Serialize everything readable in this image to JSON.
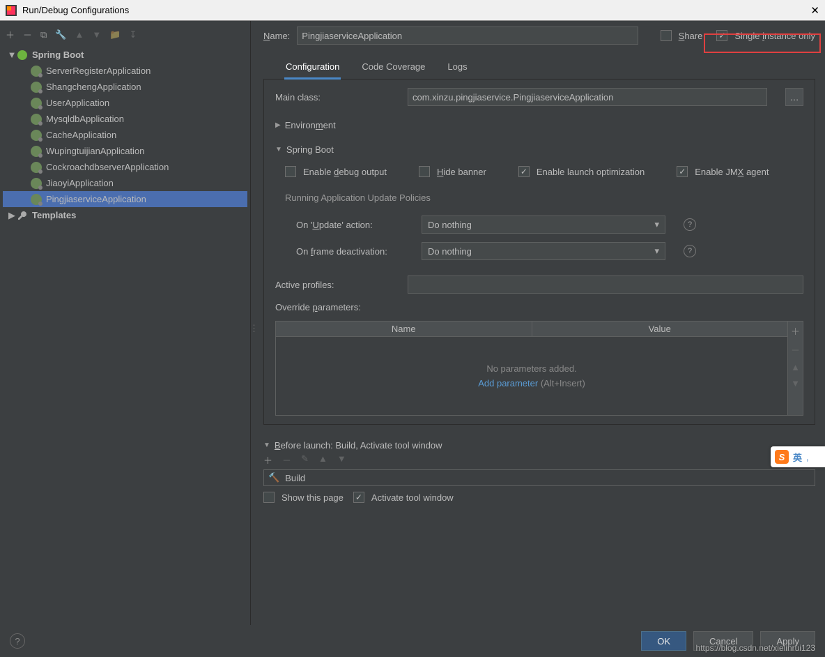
{
  "window": {
    "title": "Run/Debug Configurations"
  },
  "sidebar": {
    "root": {
      "label": "Spring Boot"
    },
    "items": [
      {
        "label": "ServerRegisterApplication"
      },
      {
        "label": "ShangchengApplication"
      },
      {
        "label": "UserApplication"
      },
      {
        "label": "MysqldbApplication"
      },
      {
        "label": "CacheApplication"
      },
      {
        "label": "WupingtuijianApplication"
      },
      {
        "label": "CockroachdbserverApplication"
      },
      {
        "label": "JiaoyiApplication"
      },
      {
        "label": "PingjiaserviceApplication"
      }
    ],
    "templates": {
      "label": "Templates"
    }
  },
  "form": {
    "name_label": "Name:",
    "name_value": "PingjiaserviceApplication",
    "share_label": "Share",
    "single_instance_label": "Single instance only",
    "tabs": {
      "t1": "Configuration",
      "t2": "Code Coverage",
      "t3": "Logs"
    },
    "main_class_label": "Main class:",
    "main_class_value": "com.xinzu.pingjiaservice.PingjiaserviceApplication",
    "environment_label": "Environment",
    "springboot_label": "Spring Boot",
    "checks": {
      "debug": "Enable debug output",
      "hide": "Hide banner",
      "launch": "Enable launch optimization",
      "jmx": "Enable JMX agent"
    },
    "policies_label": "Running Application Update Policies",
    "update_label": "On 'Update' action:",
    "update_value": "Do nothing",
    "frame_label": "On frame deactivation:",
    "frame_value": "Do nothing",
    "active_profiles_label": "Active profiles:",
    "active_profiles_value": "",
    "override_label": "Override parameters:",
    "params": {
      "col1": "Name",
      "col2": "Value",
      "empty": "No parameters added.",
      "add_link": "Add parameter",
      "add_hint": "(Alt+Insert)"
    },
    "before_launch_label": "Before launch: Build, Activate tool window",
    "build_item": "Build",
    "show_page_label": "Show this page",
    "activate_tool_label": "Activate tool window"
  },
  "footer": {
    "ok": "OK",
    "cancel": "Cancel",
    "apply": "Apply"
  },
  "ime": {
    "letter": "S",
    "mode": "英"
  },
  "watermark": "https://blog.csdn.net/xielinrui123"
}
